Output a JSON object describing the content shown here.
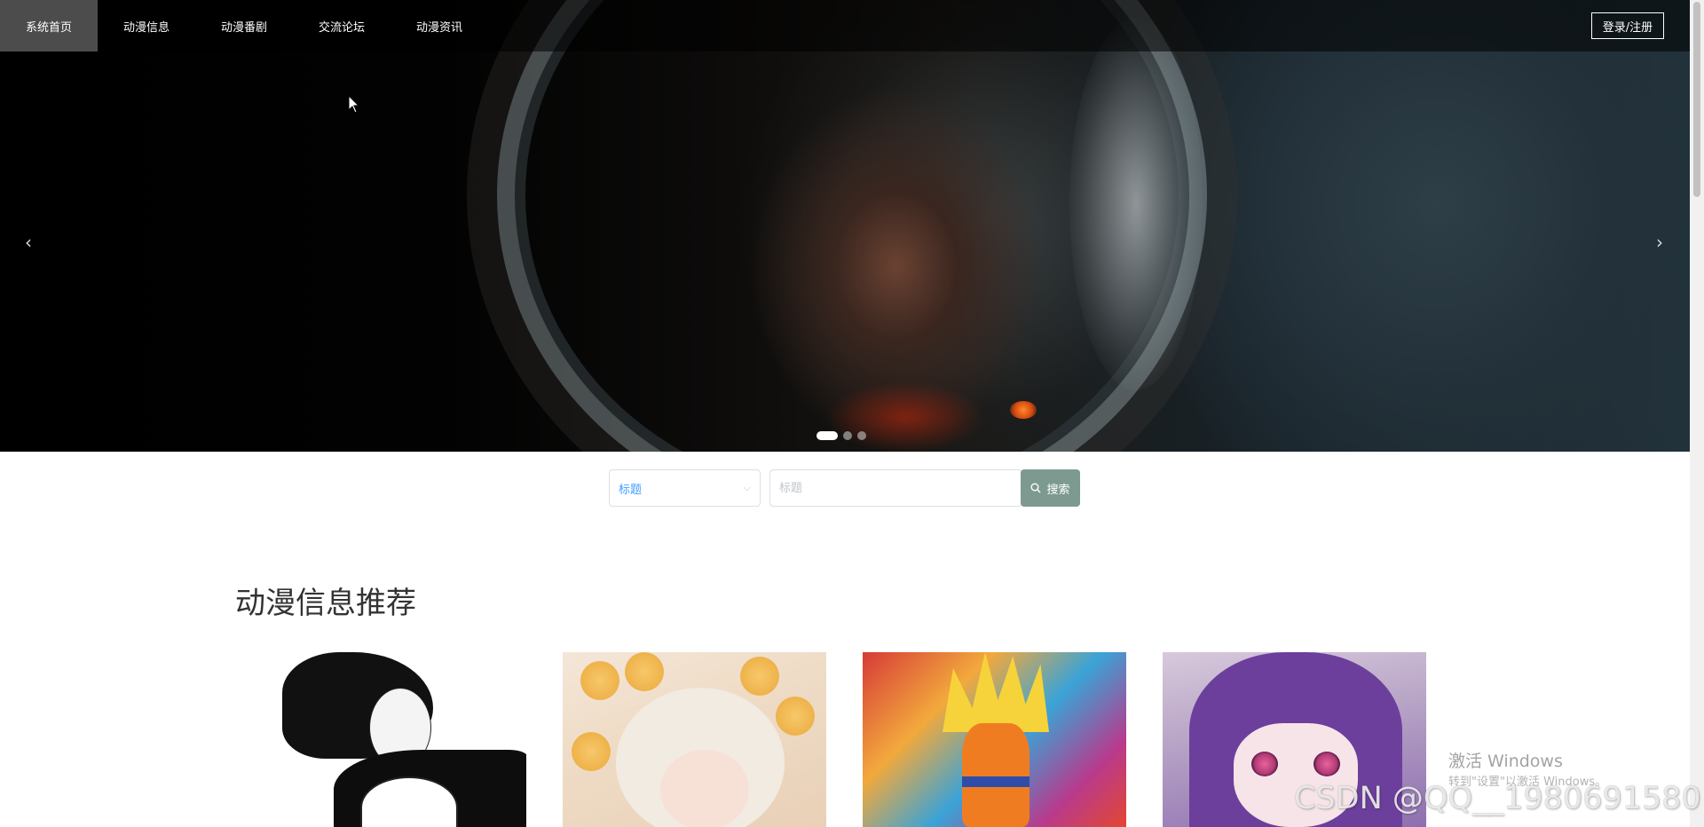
{
  "nav": {
    "items": [
      {
        "label": "系统首页",
        "active": true
      },
      {
        "label": "动漫信息",
        "active": false
      },
      {
        "label": "动漫番剧",
        "active": false
      },
      {
        "label": "交流论坛",
        "active": false
      },
      {
        "label": "动漫资讯",
        "active": false
      }
    ],
    "login_label": "登录/注册"
  },
  "carousel": {
    "prev_icon": "chevron-left-icon",
    "next_icon": "chevron-right-icon",
    "prev_glyph": "‹",
    "next_glyph": "›",
    "slide_count": 3,
    "active_slide": 1
  },
  "search": {
    "select_value": "标题",
    "select_icon": "chevron-down-icon",
    "chevron_glyph": "⌵",
    "input_placeholder": "标题",
    "button_label": "搜索",
    "button_icon": "search-icon",
    "button_color": "#7d9a91"
  },
  "section": {
    "title": "动漫信息推荐"
  },
  "watermarks": {
    "activate_title": "激活 Windows",
    "activate_sub": "转到\"设置\"以激活 Windows。",
    "csdn": "CSDN @QQ__1980691580"
  },
  "colors": {
    "nav_active_bg": "#4c4c4c",
    "select_text": "#409eff"
  }
}
